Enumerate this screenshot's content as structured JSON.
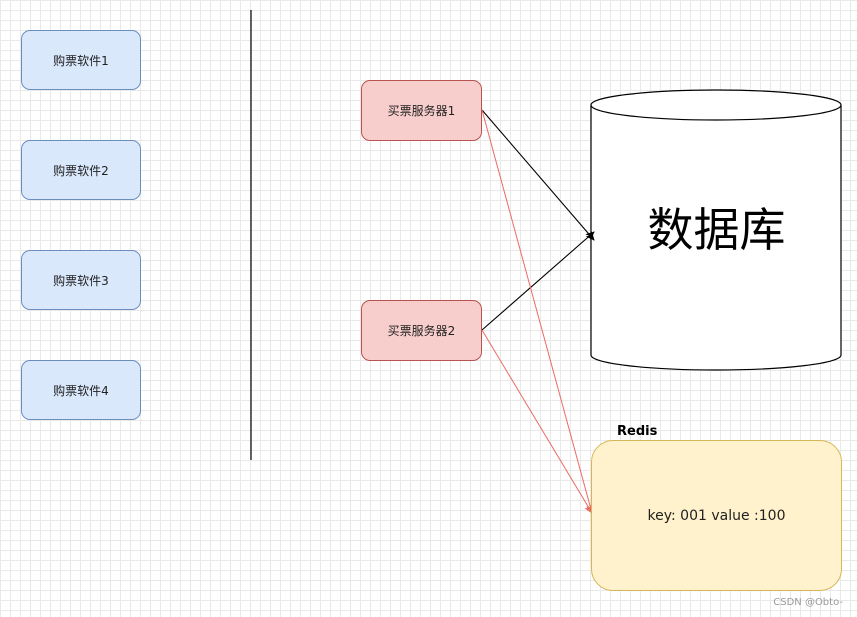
{
  "clients": [
    {
      "label": "购票软件1"
    },
    {
      "label": "购票软件2"
    },
    {
      "label": "购票软件3"
    },
    {
      "label": "购票软件4"
    }
  ],
  "servers": [
    {
      "label": "买票服务器1"
    },
    {
      "label": "买票服务器2"
    }
  ],
  "database": {
    "label": "数据库"
  },
  "redis": {
    "title": "Redis",
    "content": "key: 001 value :100"
  },
  "watermark": "CSDN @Obto-",
  "colors": {
    "client_fill": "#dae8fc",
    "client_stroke": "#6c8ebf",
    "server_fill": "#f8cecc",
    "server_stroke": "#b85450",
    "redis_fill": "#fff2cc",
    "redis_stroke": "#d6b656",
    "edge_black": "#000000",
    "edge_red": "#ea6b66"
  }
}
